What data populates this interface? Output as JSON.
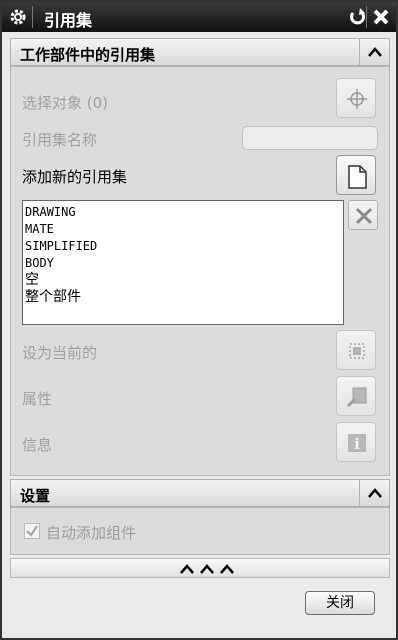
{
  "window": {
    "title": "引用集",
    "settings_icon": "gear-icon",
    "reset_icon": "reset-arrow-icon",
    "close_icon": "close-x-icon"
  },
  "section_refsets": {
    "title": "工作部件中的引用集",
    "select_object_label": "选择对象 (0)",
    "refset_name_label": "引用集名称",
    "refset_name_value": "",
    "add_new_label": "添加新的引用集",
    "list_items": [
      "DRAWING",
      "MATE",
      "SIMPLIFIED",
      "BODY",
      "空",
      "整个部件"
    ],
    "set_current_label": "设为当前的",
    "properties_label": "属性",
    "info_label": "信息"
  },
  "section_settings": {
    "title": "设置",
    "auto_add_label": "自动添加组件",
    "auto_add_checked": true
  },
  "footer": {
    "close_label": "关闭"
  },
  "colors": {
    "titlebar": "#1a1a1a",
    "panel": "#dcdcdc",
    "disabled_text": "#a0a0a0"
  }
}
